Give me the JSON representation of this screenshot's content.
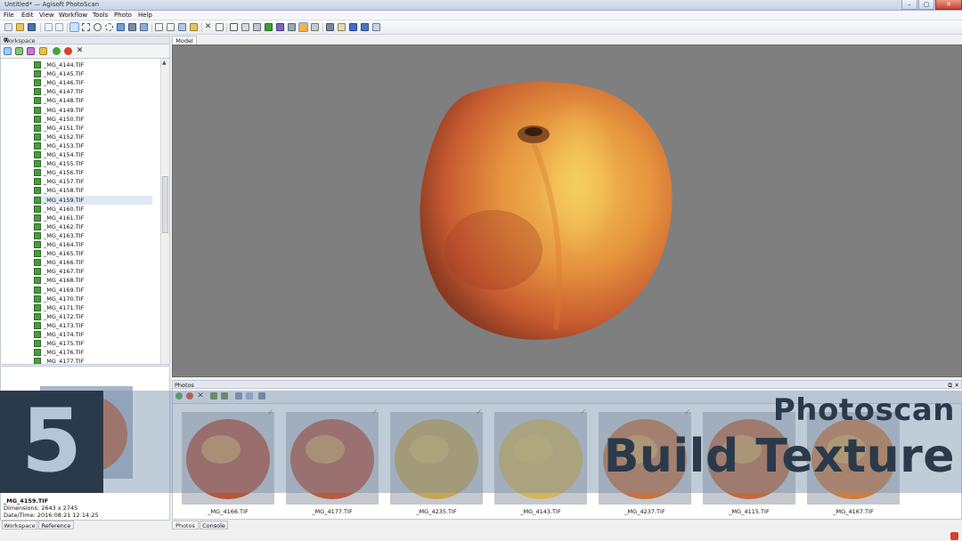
{
  "window": {
    "title": "Untitled* — Agisoft PhotoScan",
    "controls": [
      "–",
      "▢",
      "✕"
    ]
  },
  "menu": [
    "File",
    "Edit",
    "View",
    "Workflow",
    "Tools",
    "Photo",
    "Help"
  ],
  "workspace": {
    "title": "Workspace",
    "items": [
      "_MG_4144.TIF",
      "_MG_4145.TIF",
      "_MG_4146.TIF",
      "_MG_4147.TIF",
      "_MG_4148.TIF",
      "_MG_4149.TIF",
      "_MG_4150.TIF",
      "_MG_4151.TIF",
      "_MG_4152.TIF",
      "_MG_4153.TIF",
      "_MG_4154.TIF",
      "_MG_4155.TIF",
      "_MG_4156.TIF",
      "_MG_4157.TIF",
      "_MG_4158.TIF",
      "_MG_4159.TIF",
      "_MG_4160.TIF",
      "_MG_4161.TIF",
      "_MG_4162.TIF",
      "_MG_4163.TIF",
      "_MG_4164.TIF",
      "_MG_4165.TIF",
      "_MG_4166.TIF",
      "_MG_4167.TIF",
      "_MG_4168.TIF",
      "_MG_4169.TIF",
      "_MG_4170.TIF",
      "_MG_4171.TIF",
      "_MG_4172.TIF",
      "_MG_4173.TIF",
      "_MG_4174.TIF",
      "_MG_4175.TIF",
      "_MG_4176.TIF",
      "_MG_4177.TIF"
    ],
    "selected_item": "_MG_4159.TIF"
  },
  "selected_info": {
    "name": "_MG_4159.TIF",
    "dimensions": "Dimensions: 2643 x 2745",
    "datetime": "Date/Time: 2016:08:21 12:14:25"
  },
  "left_tabs": [
    "Workspace",
    "Reference"
  ],
  "model_tab": "Model",
  "photos": {
    "title": "Photos",
    "items": [
      {
        "label": "_MG_4166.TIF",
        "checked": true
      },
      {
        "label": "_MG_4177.TIF",
        "checked": true
      },
      {
        "label": "_MG_4235.TIF",
        "checked": true
      },
      {
        "label": "_MG_4143.TIF",
        "checked": true
      },
      {
        "label": "_MG_4237.TIF",
        "checked": true
      },
      {
        "label": "_MG_4115.TIF",
        "checked": false
      },
      {
        "label": "_MG_4167.TIF",
        "checked": false
      }
    ]
  },
  "bottom_tabs": [
    "Photos",
    "Console"
  ],
  "overlay": {
    "number": "5",
    "line1": "Photoscan",
    "line2": "Build Texture"
  },
  "colors": {
    "overlay_dark": "#2b3a4a",
    "overlay_number": "#b6c6d7",
    "model_bg": "#7f7f7f",
    "check": "#4aa13b"
  }
}
